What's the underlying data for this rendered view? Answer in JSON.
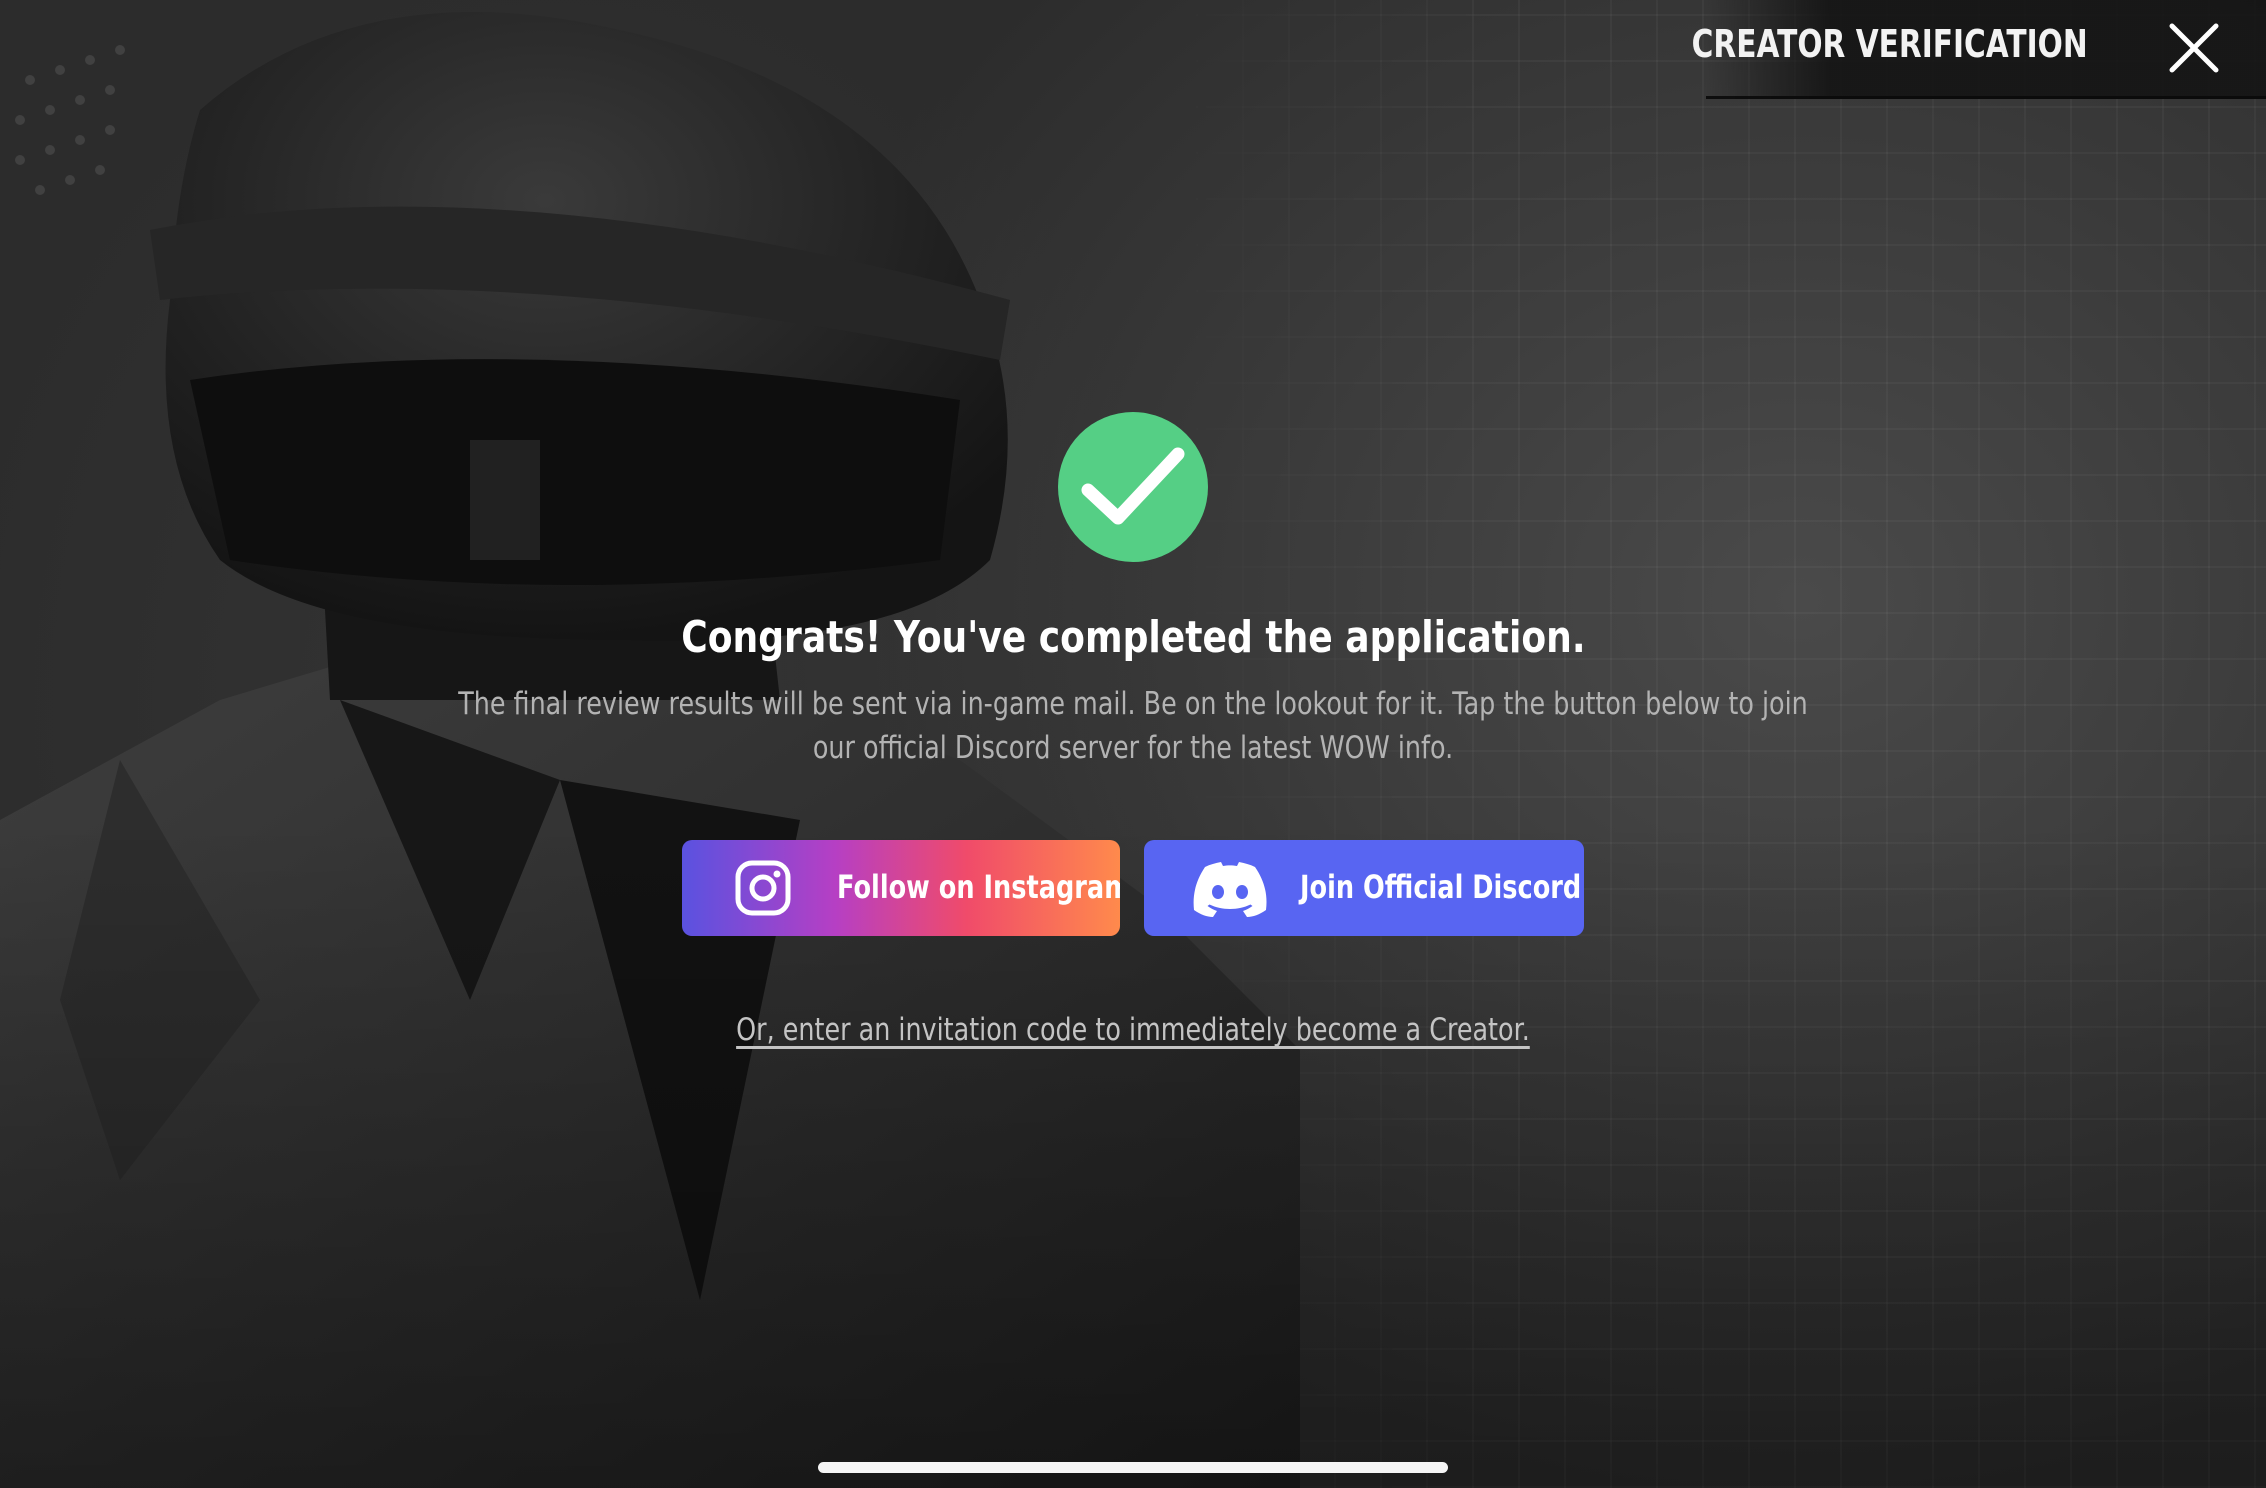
{
  "header": {
    "title": "CREATOR VERIFICATION",
    "close_icon": "close-icon"
  },
  "status": {
    "icon": "checkmark-circle-icon",
    "icon_color": "#55cf85",
    "headline": "Congrats! You've completed the application.",
    "description": "The final review results will be sent via in-game mail. Be on the lookout for it. Tap the button below to join our official Discord server for the latest WOW info."
  },
  "actions": {
    "instagram": {
      "label": "Follow on Instagram",
      "icon": "instagram-icon"
    },
    "discord": {
      "label": "Join Official Discord",
      "icon": "discord-icon",
      "color": "#5865f2"
    },
    "invite_link": "Or, enter an invitation code to immediately become a Creator."
  }
}
